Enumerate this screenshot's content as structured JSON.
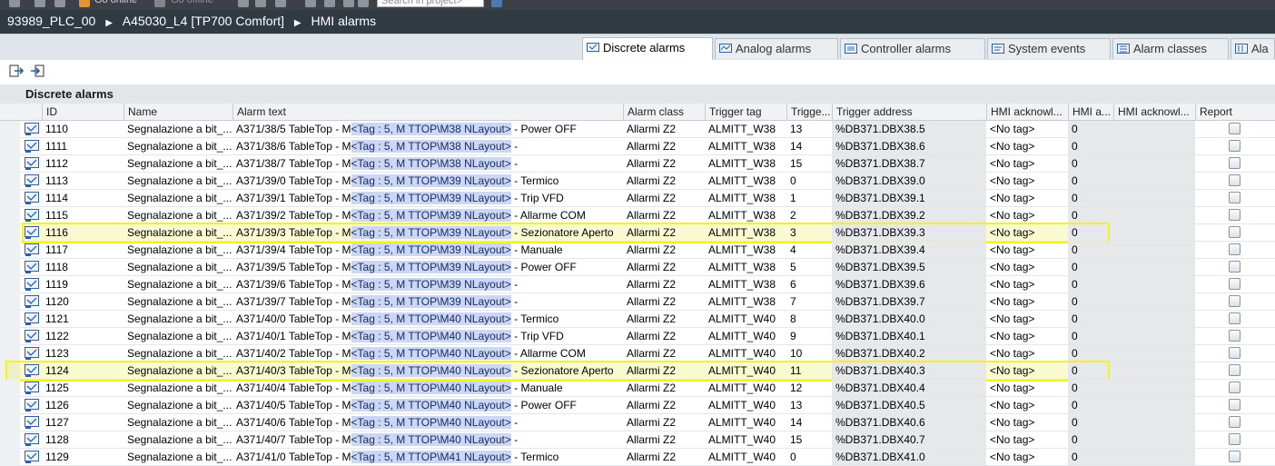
{
  "topbar": {
    "search_placeholder": "Search in project>",
    "go_online": "Go online",
    "go_offline": "Go offline"
  },
  "breadcrumb": [
    "93989_PLC_00",
    "A45030_L4 [TP700 Comfort]",
    "HMI alarms"
  ],
  "tabs": [
    {
      "label": "Discrete alarms",
      "active": true
    },
    {
      "label": "Analog alarms",
      "active": false
    },
    {
      "label": "Controller alarms",
      "active": false
    },
    {
      "label": "System events",
      "active": false
    },
    {
      "label": "Alarm classes",
      "active": false
    },
    {
      "label": "Ala",
      "active": false
    }
  ],
  "grid_title": "Discrete alarms",
  "columns": [
    "ID",
    "Name",
    "Alarm text",
    "Alarm class",
    "Trigger tag",
    "Trigge...",
    "Trigger address",
    "HMI acknowl...",
    "HMI a...",
    "HMI acknowl...",
    "Report"
  ],
  "rows": [
    {
      "id": "1110",
      "name": "Segnalazione a bit_...",
      "text_pre": "A371/38/5 TableTop - M",
      "text_tag": "<Tag : 5, M TTOP\\M38 NLayout>",
      "text_post": " - Power OFF",
      "class": "Allarmi Z2",
      "tag": "ALMITT_W38",
      "bit": "13",
      "addr": "%DB371.DBX38.5",
      "ack": "<No tag>",
      "ackbit": "0",
      "highlight": false
    },
    {
      "id": "1111",
      "name": "Segnalazione a bit_...",
      "text_pre": "A371/38/6 TableTop - M",
      "text_tag": "<Tag : 5, M TTOP\\M38 NLayout>",
      "text_post": " -",
      "class": "Allarmi Z2",
      "tag": "ALMITT_W38",
      "bit": "14",
      "addr": "%DB371.DBX38.6",
      "ack": "<No tag>",
      "ackbit": "0",
      "highlight": false
    },
    {
      "id": "1112",
      "name": "Segnalazione a bit_...",
      "text_pre": "A371/38/7 TableTop - M",
      "text_tag": "<Tag : 5, M TTOP\\M38 NLayout>",
      "text_post": " -",
      "class": "Allarmi Z2",
      "tag": "ALMITT_W38",
      "bit": "15",
      "addr": "%DB371.DBX38.7",
      "ack": "<No tag>",
      "ackbit": "0",
      "highlight": false
    },
    {
      "id": "1113",
      "name": "Segnalazione a bit_...",
      "text_pre": "A371/39/0 TableTop - M",
      "text_tag": "<Tag : 5, M TTOP\\M39 NLayout>",
      "text_post": " - Termico",
      "class": "Allarmi Z2",
      "tag": "ALMITT_W38",
      "bit": "0",
      "addr": "%DB371.DBX39.0",
      "ack": "<No tag>",
      "ackbit": "0",
      "highlight": false
    },
    {
      "id": "1114",
      "name": "Segnalazione a bit_...",
      "text_pre": "A371/39/1 TableTop - M",
      "text_tag": "<Tag : 5, M TTOP\\M39 NLayout>",
      "text_post": " - Trip VFD",
      "class": "Allarmi Z2",
      "tag": "ALMITT_W38",
      "bit": "1",
      "addr": "%DB371.DBX39.1",
      "ack": "<No tag>",
      "ackbit": "0",
      "highlight": false
    },
    {
      "id": "1115",
      "name": "Segnalazione a bit_...",
      "text_pre": "A371/39/2 TableTop - M",
      "text_tag": "<Tag : 5, M TTOP\\M39 NLayout>",
      "text_post": " - Allarme COM",
      "class": "Allarmi Z2",
      "tag": "ALMITT_W38",
      "bit": "2",
      "addr": "%DB371.DBX39.2",
      "ack": "<No tag>",
      "ackbit": "0",
      "highlight": false
    },
    {
      "id": "1116",
      "name": "Segnalazione a bit_...",
      "text_pre": "A371/39/3 TableTop - M",
      "text_tag": "<Tag : 5, M TTOP\\M39 NLayout>",
      "text_post": " - Sezionatore Aperto",
      "class": "Allarmi Z2",
      "tag": "ALMITT_W38",
      "bit": "3",
      "addr": "%DB371.DBX39.3",
      "ack": "<No tag>",
      "ackbit": "0",
      "highlight": true
    },
    {
      "id": "1117",
      "name": "Segnalazione a bit_...",
      "text_pre": "A371/39/4 TableTop - M",
      "text_tag": "<Tag : 5, M TTOP\\M39 NLayout>",
      "text_post": " - Manuale",
      "class": "Allarmi Z2",
      "tag": "ALMITT_W38",
      "bit": "4",
      "addr": "%DB371.DBX39.4",
      "ack": "<No tag>",
      "ackbit": "0",
      "highlight": false
    },
    {
      "id": "1118",
      "name": "Segnalazione a bit_...",
      "text_pre": "A371/39/5 TableTop - M",
      "text_tag": "<Tag : 5, M TTOP\\M39 NLayout>",
      "text_post": " - Power OFF",
      "class": "Allarmi Z2",
      "tag": "ALMITT_W38",
      "bit": "5",
      "addr": "%DB371.DBX39.5",
      "ack": "<No tag>",
      "ackbit": "0",
      "highlight": false
    },
    {
      "id": "1119",
      "name": "Segnalazione a bit_...",
      "text_pre": "A371/39/6 TableTop - M",
      "text_tag": "<Tag : 5, M TTOP\\M39 NLayout>",
      "text_post": " -",
      "class": "Allarmi Z2",
      "tag": "ALMITT_W38",
      "bit": "6",
      "addr": "%DB371.DBX39.6",
      "ack": "<No tag>",
      "ackbit": "0",
      "highlight": false
    },
    {
      "id": "1120",
      "name": "Segnalazione a bit_...",
      "text_pre": "A371/39/7 TableTop - M",
      "text_tag": "<Tag : 5, M TTOP\\M39 NLayout>",
      "text_post": " -",
      "class": "Allarmi Z2",
      "tag": "ALMITT_W38",
      "bit": "7",
      "addr": "%DB371.DBX39.7",
      "ack": "<No tag>",
      "ackbit": "0",
      "highlight": false
    },
    {
      "id": "1121",
      "name": "Segnalazione a bit_...",
      "text_pre": "A371/40/0 TableTop - M",
      "text_tag": "<Tag : 5, M TTOP\\M40 NLayout>",
      "text_post": " - Termico",
      "class": "Allarmi Z2",
      "tag": "ALMITT_W40",
      "bit": "8",
      "addr": "%DB371.DBX40.0",
      "ack": "<No tag>",
      "ackbit": "0",
      "highlight": false
    },
    {
      "id": "1122",
      "name": "Segnalazione a bit_...",
      "text_pre": "A371/40/1 TableTop - M",
      "text_tag": "<Tag : 5, M TTOP\\M40 NLayout>",
      "text_post": " - Trip VFD",
      "class": "Allarmi Z2",
      "tag": "ALMITT_W40",
      "bit": "9",
      "addr": "%DB371.DBX40.1",
      "ack": "<No tag>",
      "ackbit": "0",
      "highlight": false
    },
    {
      "id": "1123",
      "name": "Segnalazione a bit_...",
      "text_pre": "A371/40/2 TableTop - M",
      "text_tag": "<Tag : 5, M TTOP\\M40 NLayout>",
      "text_post": " - Allarme COM",
      "class": "Allarmi Z2",
      "tag": "ALMITT_W40",
      "bit": "10",
      "addr": "%DB371.DBX40.2",
      "ack": "<No tag>",
      "ackbit": "0",
      "highlight": false
    },
    {
      "id": "1124",
      "name": "Segnalazione a bit_...",
      "text_pre": "A371/40/3 TableTop - M",
      "text_tag": "<Tag : 5, M TTOP\\M40 NLayout>",
      "text_post": " - Sezionatore Aperto",
      "class": "Allarmi Z2",
      "tag": "ALMITT_W40",
      "bit": "11",
      "addr": "%DB371.DBX40.3",
      "ack": "<No tag>",
      "ackbit": "0",
      "highlight": true
    },
    {
      "id": "1125",
      "name": "Segnalazione a bit_...",
      "text_pre": "A371/40/4 TableTop - M",
      "text_tag": "<Tag : 5, M TTOP\\M40 NLayout>",
      "text_post": " - Manuale",
      "class": "Allarmi Z2",
      "tag": "ALMITT_W40",
      "bit": "12",
      "addr": "%DB371.DBX40.4",
      "ack": "<No tag>",
      "ackbit": "0",
      "highlight": false
    },
    {
      "id": "1126",
      "name": "Segnalazione a bit_...",
      "text_pre": "A371/40/5 TableTop - M",
      "text_tag": "<Tag : 5, M TTOP\\M40 NLayout>",
      "text_post": " - Power OFF",
      "class": "Allarmi Z2",
      "tag": "ALMITT_W40",
      "bit": "13",
      "addr": "%DB371.DBX40.5",
      "ack": "<No tag>",
      "ackbit": "0",
      "highlight": false
    },
    {
      "id": "1127",
      "name": "Segnalazione a bit_...",
      "text_pre": "A371/40/6 TableTop - M",
      "text_tag": "<Tag : 5, M TTOP\\M40 NLayout>",
      "text_post": " -",
      "class": "Allarmi Z2",
      "tag": "ALMITT_W40",
      "bit": "14",
      "addr": "%DB371.DBX40.6",
      "ack": "<No tag>",
      "ackbit": "0",
      "highlight": false
    },
    {
      "id": "1128",
      "name": "Segnalazione a bit_...",
      "text_pre": "A371/40/7 TableTop - M",
      "text_tag": "<Tag : 5, M TTOP\\M40 NLayout>",
      "text_post": " -",
      "class": "Allarmi Z2",
      "tag": "ALMITT_W40",
      "bit": "15",
      "addr": "%DB371.DBX40.7",
      "ack": "<No tag>",
      "ackbit": "0",
      "highlight": false
    },
    {
      "id": "1129",
      "name": "Segnalazione a bit_...",
      "text_pre": "A371/41/0 TableTop - M",
      "text_tag": "<Tag : 5, M TTOP\\M41 NLayout>",
      "text_post": " - Termico",
      "class": "Allarmi Z2",
      "tag": "ALMITT_W40",
      "bit": "0",
      "addr": "%DB371.DBX41.0",
      "ack": "<No tag>",
      "ackbit": "0",
      "highlight": false
    }
  ],
  "colors": {
    "highlight_border": "#f3f320",
    "tag_highlight": "#ccd8f3",
    "breadcrumb_bg": "#2f3a43"
  }
}
